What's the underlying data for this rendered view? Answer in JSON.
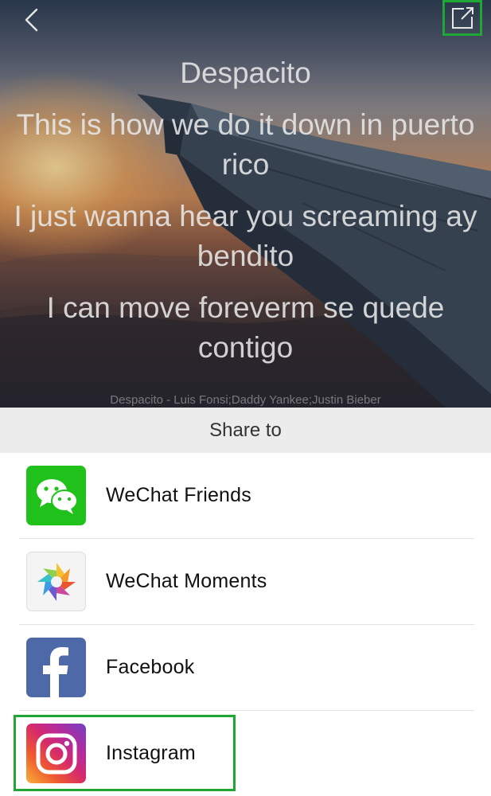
{
  "header": {
    "back_icon": "chevron-left-icon",
    "share_icon": "external-share-icon"
  },
  "lyrics": {
    "title": "Despacito",
    "lines": [
      "This is how we do it down in puerto rico",
      "I just wanna hear you screaming ay bendito",
      "I can move foreverm se quede contigo"
    ],
    "credit": "Despacito - Luis Fonsi;Daddy Yankee;Justin Bieber"
  },
  "share_sheet": {
    "title": "Share to",
    "items": [
      {
        "label": "WeChat Friends",
        "icon": "wechat-icon",
        "color": "#21c11b"
      },
      {
        "label": "WeChat Moments",
        "icon": "wechat-moments-icon",
        "color": "#f4f4f4"
      },
      {
        "label": "Facebook",
        "icon": "facebook-icon",
        "color": "#4e69a8"
      },
      {
        "label": "Instagram",
        "icon": "instagram-icon",
        "color": "#d62a6b"
      }
    ]
  },
  "colors": {
    "highlight": "#1fa634",
    "sheet_header_bg": "#ececec"
  }
}
